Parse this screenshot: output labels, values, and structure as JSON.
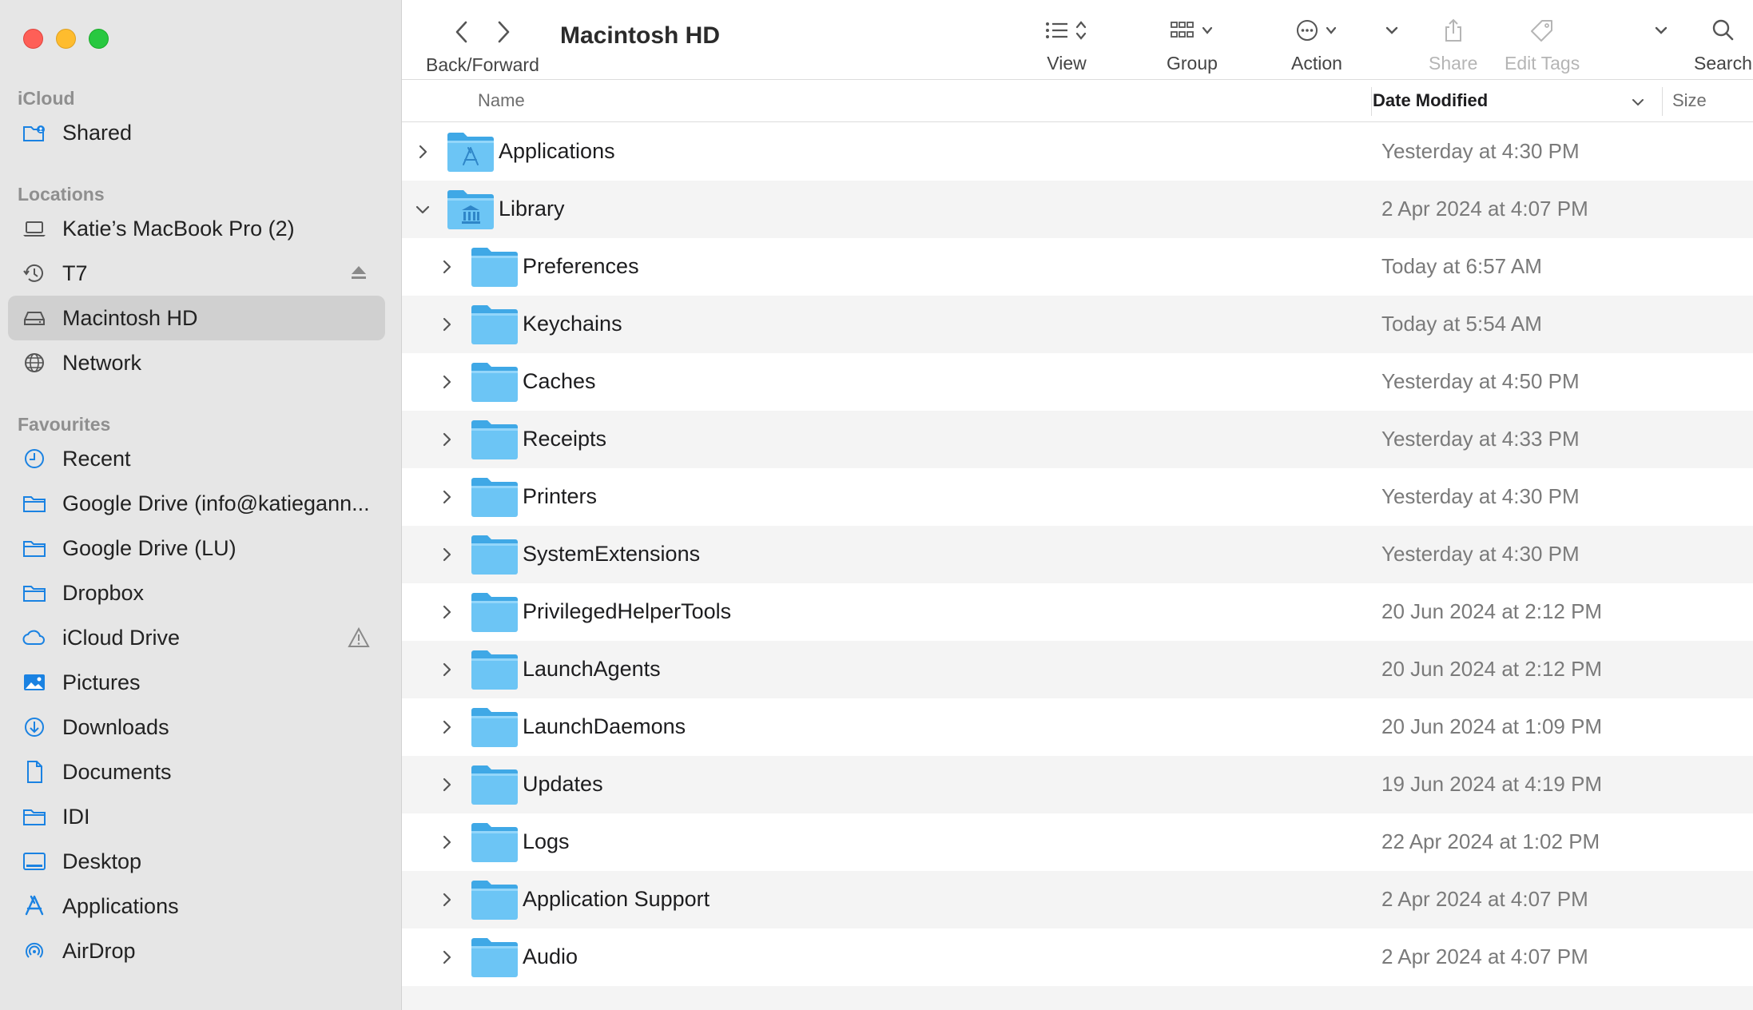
{
  "window": {
    "title": "Macintosh HD"
  },
  "toolbar": {
    "back_forward_label": "Back/Forward",
    "view_label": "View",
    "group_label": "Group",
    "action_label": "Action",
    "share_label": "Share",
    "edit_tags_label": "Edit Tags",
    "search_label": "Search"
  },
  "sidebar": {
    "icloud_title": "iCloud",
    "icloud_items": [
      {
        "label": "Shared",
        "icon": "shared-folder-icon"
      }
    ],
    "locations_title": "Locations",
    "locations_items": [
      {
        "label": "Katie’s MacBook Pro (2)",
        "icon": "laptop-icon"
      },
      {
        "label": "T7",
        "icon": "time-machine-icon"
      },
      {
        "label": "Macintosh HD",
        "icon": "hard-drive-icon",
        "selected": true
      },
      {
        "label": "Network",
        "icon": "globe-icon"
      }
    ],
    "favourites_title": "Favourites",
    "favourites_items": [
      {
        "label": "Recent",
        "icon": "clock-icon"
      },
      {
        "label": "Google Drive (info@katiegann...",
        "icon": "folder-icon"
      },
      {
        "label": "Google Drive (LU)",
        "icon": "folder-icon"
      },
      {
        "label": "Dropbox",
        "icon": "folder-icon"
      },
      {
        "label": "iCloud Drive",
        "icon": "cloud-icon"
      },
      {
        "label": "Pictures",
        "icon": "pictures-icon"
      },
      {
        "label": "Downloads",
        "icon": "download-icon"
      },
      {
        "label": "Documents",
        "icon": "document-icon"
      },
      {
        "label": "IDI",
        "icon": "folder-icon"
      },
      {
        "label": "Desktop",
        "icon": "desktop-icon"
      },
      {
        "label": "Applications",
        "icon": "applications-icon"
      },
      {
        "label": "AirDrop",
        "icon": "airdrop-icon"
      }
    ]
  },
  "columns": {
    "name": "Name",
    "date_modified": "Date Modified",
    "size": "Size"
  },
  "rows": [
    {
      "name": "Applications",
      "date": "Yesterday at 4:30 PM",
      "level": 0,
      "expanded": false,
      "icon": "applications-folder-icon"
    },
    {
      "name": "Library",
      "date": "2 Apr 2024 at 4:07 PM",
      "level": 0,
      "expanded": true,
      "icon": "library-folder-icon"
    },
    {
      "name": "Preferences",
      "date": "Today at 6:57 AM",
      "level": 1,
      "expanded": false,
      "icon": "folder-icon"
    },
    {
      "name": "Keychains",
      "date": "Today at 5:54 AM",
      "level": 1,
      "expanded": false,
      "icon": "folder-icon"
    },
    {
      "name": "Caches",
      "date": "Yesterday at 4:50 PM",
      "level": 1,
      "expanded": false,
      "icon": "folder-icon"
    },
    {
      "name": "Receipts",
      "date": "Yesterday at 4:33 PM",
      "level": 1,
      "expanded": false,
      "icon": "folder-icon"
    },
    {
      "name": "Printers",
      "date": "Yesterday at 4:30 PM",
      "level": 1,
      "expanded": false,
      "icon": "folder-icon"
    },
    {
      "name": "SystemExtensions",
      "date": "Yesterday at 4:30 PM",
      "level": 1,
      "expanded": false,
      "icon": "folder-icon"
    },
    {
      "name": "PrivilegedHelperTools",
      "date": "20 Jun 2024 at 2:12 PM",
      "level": 1,
      "expanded": false,
      "icon": "folder-icon"
    },
    {
      "name": "LaunchAgents",
      "date": "20 Jun 2024 at 2:12 PM",
      "level": 1,
      "expanded": false,
      "icon": "folder-icon"
    },
    {
      "name": "LaunchDaemons",
      "date": "20 Jun 2024 at 1:09 PM",
      "level": 1,
      "expanded": false,
      "icon": "folder-icon"
    },
    {
      "name": "Updates",
      "date": "19 Jun 2024 at 4:19 PM",
      "level": 1,
      "expanded": false,
      "icon": "folder-icon"
    },
    {
      "name": "Logs",
      "date": "22 Apr 2024 at 1:02 PM",
      "level": 1,
      "expanded": false,
      "icon": "folder-icon"
    },
    {
      "name": "Application Support",
      "date": "2 Apr 2024 at 4:07 PM",
      "level": 1,
      "expanded": false,
      "icon": "folder-icon"
    },
    {
      "name": "Audio",
      "date": "2 Apr 2024 at 4:07 PM",
      "level": 1,
      "expanded": false,
      "icon": "folder-icon"
    }
  ],
  "colors": {
    "accent": "#1a82e2",
    "folder_body": "#6cc5f5",
    "folder_tab": "#3fa8e6",
    "sidebar_bg": "#e6e6e6",
    "selected_bg": "#d0d0d0"
  }
}
